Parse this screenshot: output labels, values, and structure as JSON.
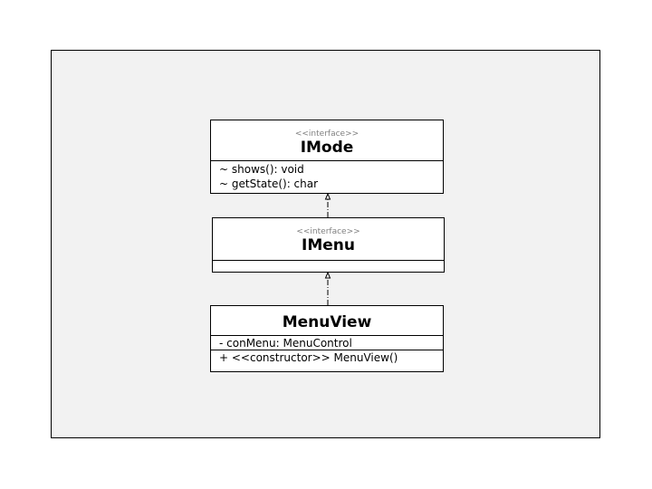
{
  "diagram": {
    "classes": [
      {
        "id": "imode",
        "stereotype": "<<interface>>",
        "name": "IMode",
        "attributes": [],
        "operations": [
          "~ shows(): void",
          "~ getState(): char"
        ]
      },
      {
        "id": "imenu",
        "stereotype": "<<interface>>",
        "name": "IMenu",
        "attributes": [],
        "operations": []
      },
      {
        "id": "menuview",
        "stereotype": "",
        "name": "MenuView",
        "attributes": [
          "- conMenu: MenuControl"
        ],
        "operations": [
          "+ <<constructor>> MenuView()"
        ]
      }
    ],
    "relations": [
      {
        "type": "realization",
        "from": "imenu",
        "to": "imode"
      },
      {
        "type": "realization",
        "from": "menuview",
        "to": "imenu"
      }
    ]
  }
}
